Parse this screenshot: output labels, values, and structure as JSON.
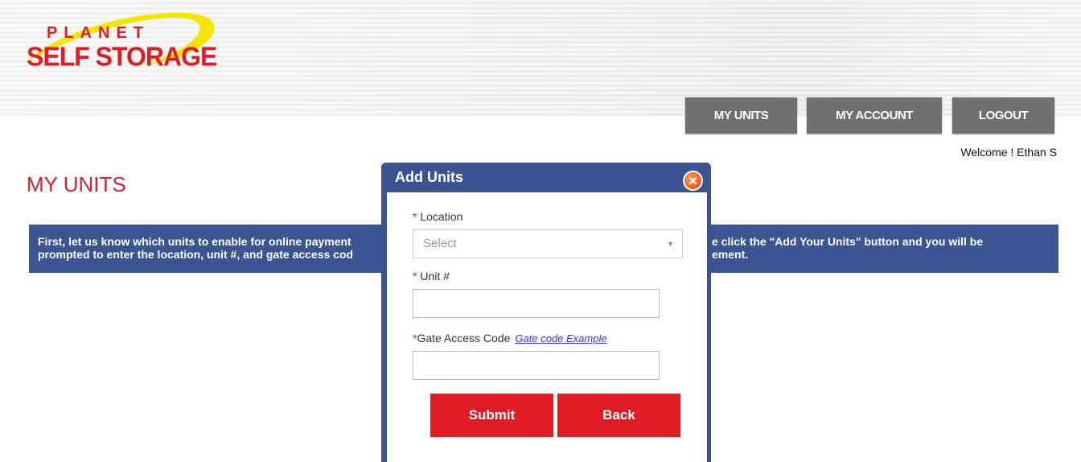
{
  "brand": {
    "logo_line1": "PLANET",
    "logo_line2": "SELF STORAGE",
    "logo_red": "#e11b22",
    "logo_yellow": "#f4e400"
  },
  "nav": {
    "items": [
      {
        "label": "MY UNITS"
      },
      {
        "label": "MY ACCOUNT"
      },
      {
        "label": "LOGOUT"
      }
    ],
    "button_color": "#707070"
  },
  "user": {
    "welcome": "Welcome ! Ethan S"
  },
  "page": {
    "title": "MY UNITS",
    "title_color": "#d6222a"
  },
  "info": {
    "left_line1": "First, let us know which units to enable for online payment",
    "left_line2": "prompted to enter the location, unit #, and gate access cod",
    "right_line1": "e click the \"Add Your Units\" button and you will be",
    "right_line2": "ement.",
    "bar_color": "#3b5592"
  },
  "modal": {
    "title": "Add Units",
    "close_glyph": "✕",
    "location": {
      "required_mark": "*",
      "label": " Location",
      "selected": "Select",
      "arrow_glyph": "▼"
    },
    "unit": {
      "required_mark": "*",
      "label": " Unit #",
      "value": ""
    },
    "gate": {
      "required_mark": "*",
      "label": "Gate Access Code",
      "link": "Gate code Example",
      "value": ""
    },
    "submit_label": "Submit",
    "back_label": "Back",
    "button_color": "#e11b22"
  }
}
